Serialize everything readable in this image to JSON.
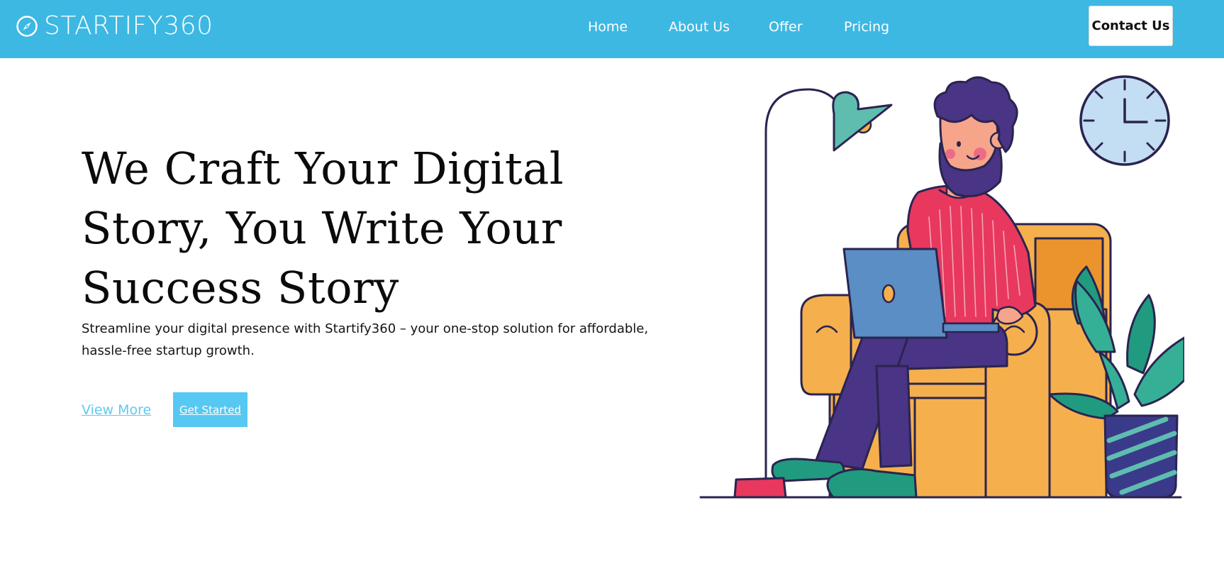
{
  "brand": {
    "name": "STARTIFY360",
    "logo_icon": "compass-icon"
  },
  "nav": {
    "links": [
      "Home",
      "About Us",
      "Offer",
      "Pricing"
    ],
    "contact_label": "Contact Us"
  },
  "hero": {
    "title": "We Craft Your Digital Story, You Write Your Success Story",
    "subtitle": "Streamline your digital presence with Startify360 – your one-stop solution for affordable, hassle-free startup growth.",
    "view_more_label": "View More",
    "get_started_label": "Get Started"
  },
  "colors": {
    "nav_background": "#3cb8e3",
    "accent": "#57c8f2",
    "link": "#5ecbf1"
  }
}
